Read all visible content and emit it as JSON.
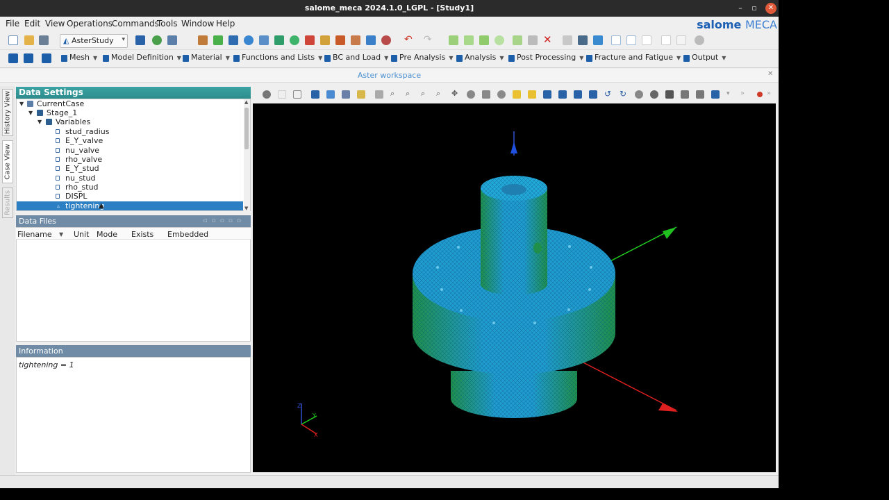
{
  "window": {
    "title": "salome_meca 2024.1.0_LGPL - [Study1]"
  },
  "menubar": {
    "items": [
      "File",
      "Edit",
      "View",
      "Operations",
      "Commands",
      "Tools",
      "Window",
      "Help"
    ]
  },
  "brand": {
    "main": "salome",
    "sub": "MECA"
  },
  "toolbar": {
    "module_combo": "AsterStudy"
  },
  "modules": [
    {
      "label": "Mesh"
    },
    {
      "label": "Model Definition"
    },
    {
      "label": "Material"
    },
    {
      "label": "Functions and Lists"
    },
    {
      "label": "BC and Load"
    },
    {
      "label": "Pre Analysis"
    },
    {
      "label": "Analysis"
    },
    {
      "label": "Post Processing"
    },
    {
      "label": "Fracture and Fatigue"
    },
    {
      "label": "Output"
    }
  ],
  "workspace": {
    "title": "Aster workspace"
  },
  "side_tabs": {
    "history": "History View",
    "case": "Case View",
    "results": "Results"
  },
  "data_settings": {
    "header": "Data Settings",
    "tree": {
      "case": "CurrentCase",
      "stage": "Stage_1",
      "variables_folder": "Variables",
      "variables": [
        "stud_radius",
        "E_Y_valve",
        "nu_valve",
        "rho_valve",
        "E_Y_stud",
        "nu_stud",
        "rho_stud",
        "DISPL",
        "tightening"
      ],
      "selected": "tightening"
    }
  },
  "data_files": {
    "header": "Data Files",
    "columns": [
      "Filename",
      "Unit",
      "Mode",
      "Exists",
      "Embedded"
    ]
  },
  "information": {
    "header": "Information",
    "text": "tightening = 1"
  },
  "axes_labels": {
    "x": "X",
    "y": "Y",
    "z": "Z"
  },
  "colors": {
    "mesh": "#1f9bd0",
    "mesh_side": "#1f8f5a",
    "selection": "#2c7fc2",
    "data_settings_header": "#2d8c8c"
  }
}
